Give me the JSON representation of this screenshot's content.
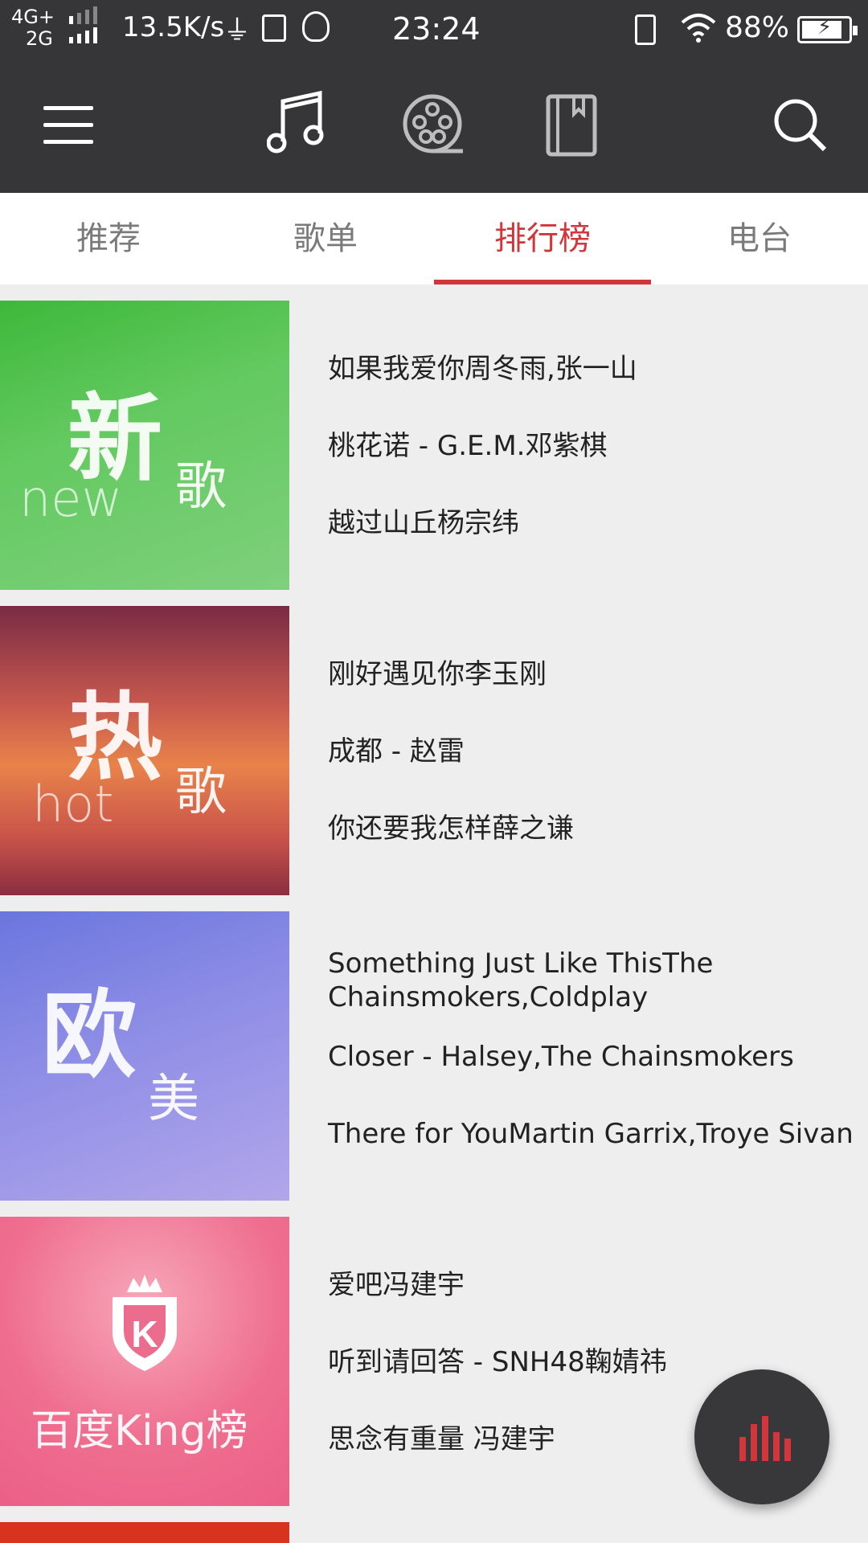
{
  "status_bar": {
    "network_top": "4G+",
    "network_bottom": "2G",
    "speed": "13.5K/s",
    "time": "23:24",
    "battery": "88%",
    "battery_level": 0.88,
    "icons": [
      "signal-icon",
      "usb-icon",
      "app-icon",
      "penguin-icon",
      "vibrate-icon",
      "wifi-icon",
      "battery-icon"
    ]
  },
  "app_bar": {
    "icons": [
      "menu-icon",
      "music-note-icon",
      "video-reel-icon",
      "book-icon",
      "search-icon"
    ],
    "active_color": "#ffffff"
  },
  "tabs": [
    {
      "label": "推荐",
      "active": false
    },
    {
      "label": "歌单",
      "active": false
    },
    {
      "label": "排行榜",
      "active": true
    },
    {
      "label": "电台",
      "active": false
    }
  ],
  "accent_color": "#d0363a",
  "charts": [
    {
      "cover": {
        "big": "新",
        "small": "歌",
        "eng": "new"
      },
      "songs": [
        "如果我爱你周冬雨,张一山",
        "桃花诺  - G.E.M.邓紫棋",
        "越过山丘杨宗纬"
      ]
    },
    {
      "cover": {
        "big": "热",
        "small": "歌",
        "eng": "hot"
      },
      "songs": [
        "刚好遇见你李玉刚",
        "成都 - 赵雷",
        "你还要我怎样薛之谦"
      ]
    },
    {
      "cover": {
        "big": "欧",
        "small": "美",
        "eng": ""
      },
      "songs": [
        "Something Just Like ThisThe Chainsmokers,Coldplay",
        "Closer - Halsey,The Chainsmokers",
        "There for YouMartin Garrix,Troye Sivan"
      ]
    },
    {
      "cover": {
        "big": "",
        "small": "百度King榜",
        "eng": ""
      },
      "songs": [
        "爱吧冯建宇",
        "听到请回答 - SNH48鞠婧祎",
        "思念有重量 冯建宇"
      ]
    }
  ],
  "fab": {
    "icon": "equalizer-icon"
  }
}
